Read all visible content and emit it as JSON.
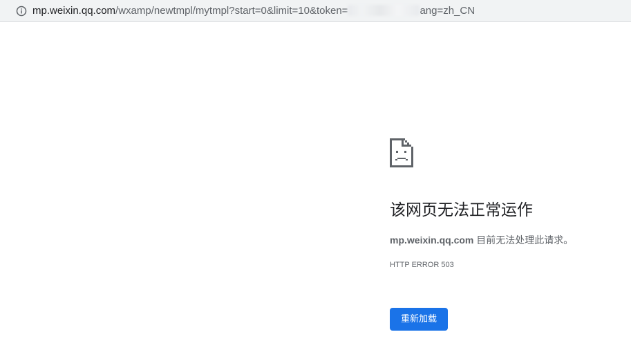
{
  "browser": {
    "url_host": "mp.weixin.qq.com",
    "url_path_before_token": "/wxamp/newtmpl/mytmpl?start=0&limit=10&token=",
    "url_after_redaction": "ang=zh_CN",
    "info_icon": "info-icon"
  },
  "error": {
    "icon": "sad-document-icon",
    "title": "该网页无法正常运作",
    "host": "mp.weixin.qq.com",
    "message": " 目前无法处理此请求。",
    "code": "HTTP ERROR 503",
    "reload_label": "重新加载"
  },
  "colors": {
    "accent": "#1a73e8",
    "text_primary": "#202124",
    "text_secondary": "#5f6368",
    "toolbar_bg": "#f1f3f4"
  }
}
